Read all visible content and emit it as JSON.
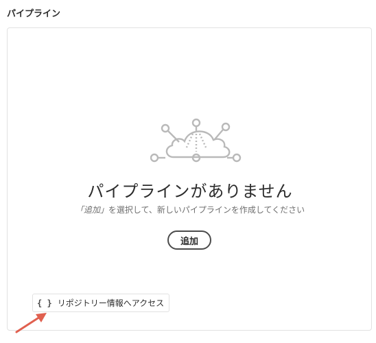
{
  "section": {
    "title": "パイプライン"
  },
  "empty_state": {
    "illustration_icon": "cloud-pipeline-illustration-icon",
    "title": "パイプラインがありません",
    "description_prefix": "「追加」",
    "description_suffix": "を選択して、新しいパイプラインを作成してください",
    "add_button_label": "追加"
  },
  "repo_link": {
    "icon": "braces-icon",
    "icon_text": "{ }",
    "label": "リポジトリー情報へアクセス"
  },
  "annotation": {
    "icon": "red-arrow-icon",
    "color": "#e0604f"
  }
}
